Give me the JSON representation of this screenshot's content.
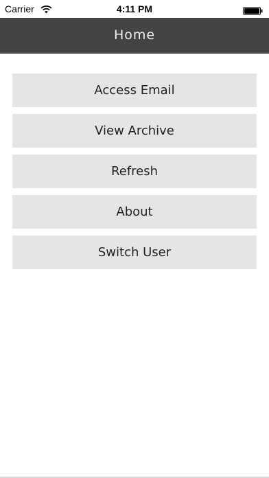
{
  "status_bar": {
    "carrier": "Carrier",
    "time": "4:11 PM",
    "wifi_icon": "wifi-icon",
    "battery_icon": "battery-icon"
  },
  "nav_bar": {
    "title": "Home",
    "background_color": "#444444"
  },
  "menu": {
    "button_color": "#e5e5e5",
    "items": [
      {
        "label": "Access Email"
      },
      {
        "label": "View Archive"
      },
      {
        "label": "Refresh"
      },
      {
        "label": "About"
      },
      {
        "label": "Switch User"
      }
    ]
  }
}
